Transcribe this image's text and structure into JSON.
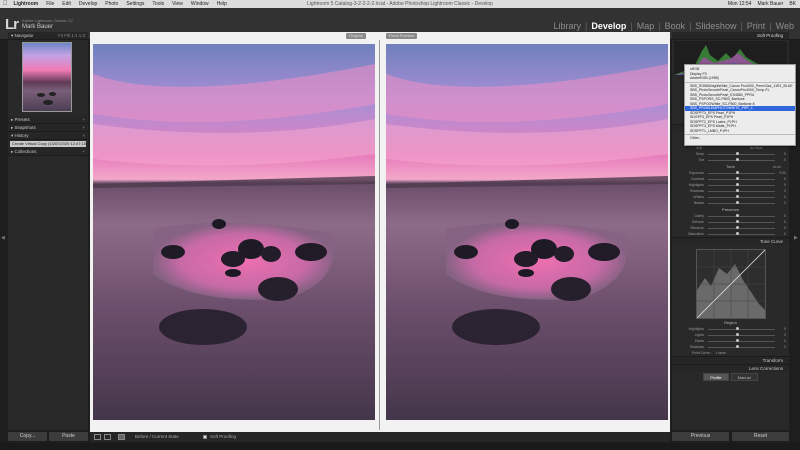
{
  "menubar": {
    "app": "Lightroom",
    "items": [
      "File",
      "Edit",
      "Develop",
      "Photo",
      "Settings",
      "Tools",
      "View",
      "Window",
      "Help"
    ],
    "window_title": "Lightroom 5 Catalog-3-2-2-2-2.lrcat - Adobe Photoshop Lightroom Classic - Develop",
    "time": "Mon 12:54",
    "user": "Mark Bauer",
    "region": "BK"
  },
  "identity": {
    "logo": "Lr",
    "catalog": "Adobe Lightroom Classic CC",
    "user": "Mark Bauer"
  },
  "modules": [
    "Library",
    "Develop",
    "Map",
    "Book",
    "Slideshow",
    "Print",
    "Web"
  ],
  "active_module": "Develop",
  "left_panel": {
    "navigator": {
      "title": "Navigator",
      "options": "Fit   Fill   1:1   1:3"
    },
    "presets": "Presets",
    "snapshots": "Snapshots",
    "history": "History",
    "history_item": "Create Virtual Copy (13/07/2020 12:47:15)",
    "collections": "Collections",
    "copy_button": "Copy...",
    "paste_button": "Paste"
  },
  "views": {
    "before_label": "Original",
    "after_label": "Proof Preview"
  },
  "toolbar": {
    "before_after": "Before / Current State",
    "soft_proofing": "Soft Proofing"
  },
  "right_panel": {
    "header": "Soft Proofing",
    "proof_header": "Show Proof",
    "basic_title": "Basic",
    "treatment_color": "Color",
    "treatment_bw": "Black & White",
    "profile_label": "Profile :",
    "profile_value": "Color",
    "wb_label": "WB :",
    "wb_value": "As Shot",
    "tone_label": "Tone",
    "tone_auto": "Auto",
    "presence_label": "Presence",
    "tone_curve": "Tone Curve",
    "region_label": "Region",
    "point_curve_label": "Point Curve :",
    "point_curve_value": "Linear",
    "transform": "Transform",
    "lens_corrections": "Lens Corrections",
    "lens_tab_profile": "Profile",
    "lens_tab_manual": "Manual",
    "previous_button": "Previous",
    "reset_button": "Reset",
    "basic_rows": [
      {
        "label": "Temp",
        "value": "0"
      },
      {
        "label": "Tint",
        "value": "0"
      }
    ],
    "tone_rows": [
      {
        "label": "Exposure",
        "value": "0.00"
      },
      {
        "label": "Contrast",
        "value": "0"
      },
      {
        "label": "Highlights",
        "value": "0"
      },
      {
        "label": "Shadows",
        "value": "0"
      },
      {
        "label": "Whites",
        "value": "0"
      },
      {
        "label": "Blacks",
        "value": "0"
      }
    ],
    "presence_rows": [
      {
        "label": "Clarity",
        "value": "0"
      },
      {
        "label": "Dehaze",
        "value": "0"
      },
      {
        "label": "Vibrance",
        "value": "0"
      },
      {
        "label": "Saturation",
        "value": "0"
      }
    ],
    "curve_rows": [
      {
        "label": "Highlights",
        "value": "0"
      },
      {
        "label": "Lights",
        "value": "0"
      },
      {
        "label": "Darks",
        "value": "0"
      },
      {
        "label": "Shadows",
        "value": "0"
      }
    ]
  },
  "profile_popup": {
    "top": [
      "sRGB",
      "Display P3",
      "AdobeRGB (1998)"
    ],
    "items": [
      "SBS_RGB6WrightWhite_Canon Pro4000_PermGlaz_11R1_BLUE",
      "SBS_PhotoSmoothPearl_CanonPro4000_Temp-FL",
      "SBS_PhotoSmoothPearl_ES4880_PPRU",
      "SBS_PSPORS_SC-P800_Baritone",
      "SBS_PSPOOWhite_SC-P800_Baritone-K",
      "SBS_PROBLEMPHOTOWHITE_PRP_1",
      "SDSPPT3_EPS Pearl_P1PH",
      "SDGPF3_EPS Pearl_P1PH",
      "SDSPPT2_EPS Lustre_P1PH",
      "SDSPPT3_EPS Matte_P1PH",
      "SDSPPT1_LMBO_P1PH"
    ],
    "selected_index": 5,
    "other": "Other..."
  }
}
